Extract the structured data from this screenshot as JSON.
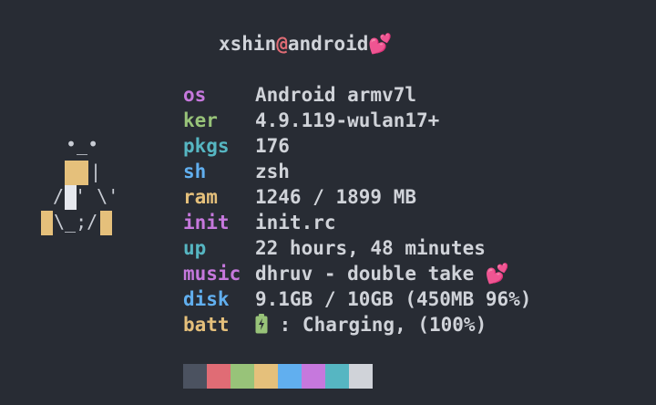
{
  "title": {
    "user": "xshin",
    "at": "@",
    "host": "android",
    "emoji": "💕"
  },
  "info": [
    {
      "key": "os",
      "value": "Android armv7l",
      "color": "#c678dd"
    },
    {
      "key": "ker",
      "value": "4.9.119-wulan17+",
      "color": "#98c379"
    },
    {
      "key": "pkgs",
      "value": "176",
      "color": "#56b6c2"
    },
    {
      "key": "sh",
      "value": "zsh",
      "color": "#61afef"
    },
    {
      "key": "ram",
      "value": "1246 / 1899 MB",
      "color": "#e5c07b"
    },
    {
      "key": "init",
      "value": "init.rc",
      "color": "#c678dd"
    },
    {
      "key": "up",
      "value": "22 hours, 48 minutes",
      "color": "#56b6c2"
    },
    {
      "key": "music",
      "value": "dhruv - double take 💕",
      "color": "#c678dd"
    },
    {
      "key": "disk",
      "value": "9.1GB / 10GB (450MB 96%)",
      "color": "#61afef"
    },
    {
      "key": "batt",
      "value": " : Charging, (100%)",
      "color": "#e5c07b"
    }
  ],
  "battery_icon": "battery-charging-icon",
  "ascii": {
    "face": "•_•",
    "arms": "/ ' \\'",
    "legs": "\\_;/"
  },
  "palette": [
    "#4b5260",
    "#e06c75",
    "#98c379",
    "#e5c07b",
    "#61afef",
    "#c678dd",
    "#56b6c2",
    "#d0d3d9"
  ]
}
